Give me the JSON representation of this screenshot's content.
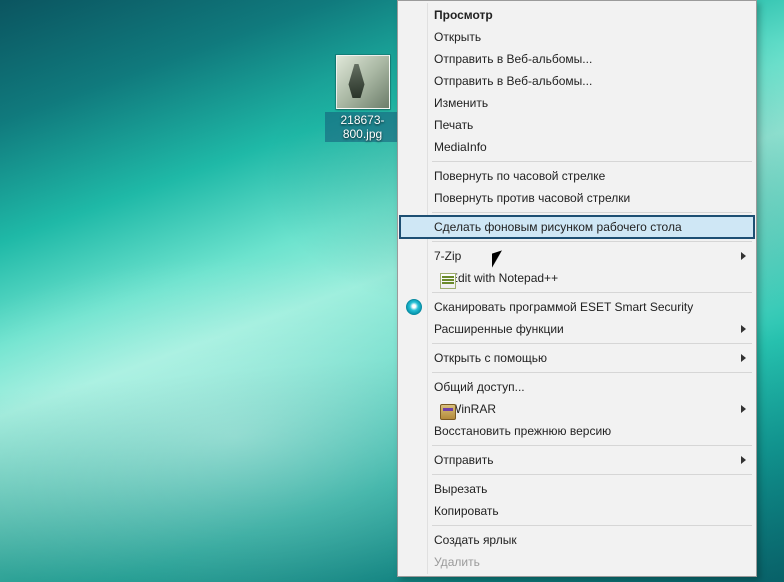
{
  "desktop": {
    "file": {
      "label": "218673- ... 800.jpg",
      "label_line1": "218673-",
      "label_line2": "800.jpg"
    }
  },
  "menu": {
    "items": [
      {
        "kind": "item",
        "label": "Просмотр",
        "bold": true
      },
      {
        "kind": "item",
        "label": "Открыть"
      },
      {
        "kind": "item",
        "label": "Отправить в Веб-альбомы..."
      },
      {
        "kind": "item",
        "label": "Отправить в Веб-альбомы..."
      },
      {
        "kind": "item",
        "label": "Изменить"
      },
      {
        "kind": "item",
        "label": "Печать"
      },
      {
        "kind": "item",
        "label": "MediaInfo"
      },
      {
        "kind": "sep"
      },
      {
        "kind": "item",
        "label": "Повернуть по часовой стрелке"
      },
      {
        "kind": "item",
        "label": "Повернуть против часовой стрелки"
      },
      {
        "kind": "sep"
      },
      {
        "kind": "item",
        "label": "Сделать фоновым рисунком рабочего стола",
        "highlight": true
      },
      {
        "kind": "sep"
      },
      {
        "kind": "item",
        "label": "7-Zip",
        "submenu": true
      },
      {
        "kind": "item",
        "label": "Edit with Notepad++",
        "icon": "notepadpp"
      },
      {
        "kind": "sep"
      },
      {
        "kind": "item",
        "label": "Сканировать программой ESET Smart Security",
        "icon": "eset"
      },
      {
        "kind": "item",
        "label": "Расширенные функции",
        "submenu": true
      },
      {
        "kind": "sep"
      },
      {
        "kind": "item",
        "label": "Открыть с помощью",
        "submenu": true
      },
      {
        "kind": "sep"
      },
      {
        "kind": "item",
        "label": "Общий доступ..."
      },
      {
        "kind": "item",
        "label": "WinRAR",
        "submenu": true,
        "icon": "winrar"
      },
      {
        "kind": "item",
        "label": "Восстановить прежнюю версию"
      },
      {
        "kind": "sep"
      },
      {
        "kind": "item",
        "label": "Отправить",
        "submenu": true
      },
      {
        "kind": "sep"
      },
      {
        "kind": "item",
        "label": "Вырезать"
      },
      {
        "kind": "item",
        "label": "Копировать"
      },
      {
        "kind": "sep"
      },
      {
        "kind": "item",
        "label": "Создать ярлык"
      },
      {
        "kind": "item",
        "label": "Удалить",
        "disabled": true
      }
    ]
  }
}
